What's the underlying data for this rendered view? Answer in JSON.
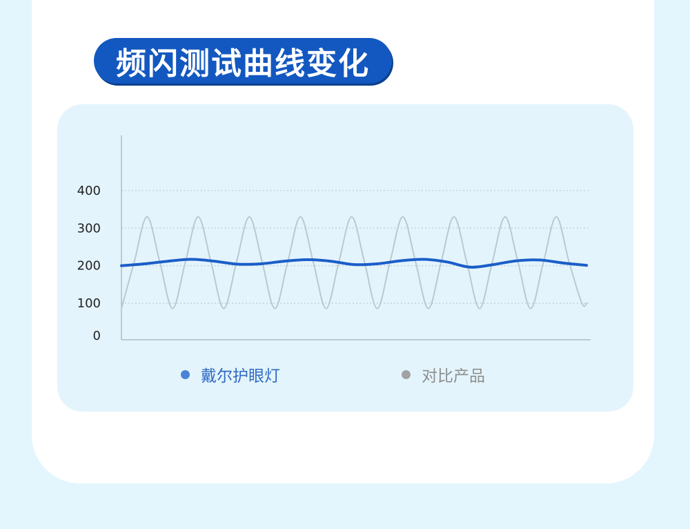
{
  "title": "频闪测试曲线变化",
  "legend": {
    "series_a": "戴尔护眼灯",
    "series_b": "对比产品"
  },
  "colors": {
    "title_bg": "#1358c0",
    "series_a": "#1a5ec8",
    "series_b": "#b9c9d1",
    "panel_bg": "#e4f4fc",
    "page_bg": "#e3f6fd"
  },
  "chart_data": {
    "type": "line",
    "title": "",
    "xlabel": "",
    "ylabel": "",
    "yticks": [
      0,
      100,
      200,
      300,
      400
    ],
    "ylim": [
      0,
      400
    ],
    "grid": true,
    "legend_position": "bottom",
    "series": [
      {
        "name": "戴尔护眼灯",
        "color": "#1a5ec8",
        "x": [
          0,
          0.05,
          0.1,
          0.15,
          0.2,
          0.25,
          0.3,
          0.35,
          0.4,
          0.45,
          0.5,
          0.55,
          0.6,
          0.65,
          0.7,
          0.75,
          0.8,
          0.85,
          0.9,
          0.95,
          1
        ],
        "y": [
          200,
          205,
          212,
          217,
          212,
          204,
          205,
          212,
          216,
          212,
          203,
          205,
          213,
          217,
          210,
          196,
          203,
          213,
          215,
          207,
          201
        ]
      },
      {
        "name": "对比产品",
        "color": "#b9c9d1",
        "x": [
          0,
          0.0275,
          0.055,
          0.0825,
          0.11,
          0.1375,
          0.165,
          0.1925,
          0.22,
          0.2475,
          0.275,
          0.3025,
          0.33,
          0.3575,
          0.385,
          0.4125,
          0.44,
          0.4675,
          0.495,
          0.5225,
          0.55,
          0.5775,
          0.605,
          0.6325,
          0.66,
          0.6875,
          0.715,
          0.7425,
          0.77,
          0.7975,
          0.825,
          0.8525,
          0.88,
          0.9075,
          0.935,
          0.9625,
          0.99,
          1
        ],
        "y": [
          86,
          210,
          330,
          210,
          86,
          210,
          330,
          210,
          86,
          210,
          330,
          210,
          86,
          210,
          330,
          210,
          86,
          210,
          330,
          210,
          86,
          210,
          330,
          210,
          86,
          210,
          330,
          210,
          86,
          210,
          330,
          210,
          86,
          210,
          330,
          210,
          100,
          100
        ]
      }
    ]
  }
}
